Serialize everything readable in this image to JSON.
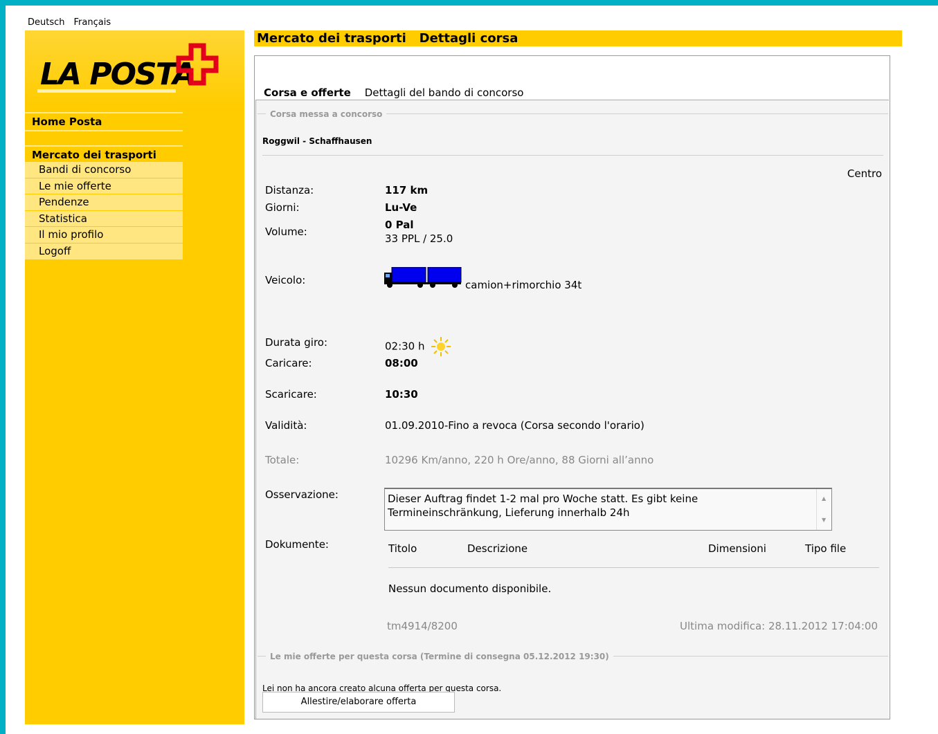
{
  "lang": {
    "de": "Deutsch",
    "fr": "Français"
  },
  "logo": {
    "text": "LA POSTA",
    "brand_color": "#ffcc00",
    "cross_color": "#e2001a"
  },
  "nav": {
    "home": "Home Posta",
    "section": "Mercato dei trasporti",
    "items": [
      {
        "label": "Bandi di concorso"
      },
      {
        "label": "Le mie offerte"
      },
      {
        "label": "Pendenze"
      },
      {
        "label": "Statistica"
      },
      {
        "label": "Il mio profilo"
      },
      {
        "label": "Logoff"
      }
    ]
  },
  "header": {
    "title": "Mercato dei trasporti   Dettagli corsa"
  },
  "tabs": {
    "active": "Corsa e offerte",
    "other": "Dettagli del bando di concorso"
  },
  "trip": {
    "legend": "Corsa messa a concorso",
    "route": "Roggwil - Schaffhausen",
    "centro": "Centro",
    "distance_label": "Distanza:",
    "distance": "117 km",
    "days_label": "Giorni:",
    "days": "Lu-Ve",
    "volume_label": "Volume:",
    "volume_pal": "0 Pal",
    "volume_ppl": "33 PPL / 25.0",
    "vehicle_label": "Veicolo:",
    "vehicle": "camion+rimorchio 34t",
    "vehicle_icon": "truck-trailer-icon",
    "duration_label": "Durata giro:",
    "duration": "02:30 h",
    "duration_icon": "sun-icon",
    "load_label": "Caricare:",
    "load": "08:00",
    "unload_label": "Scaricare:",
    "unload": "10:30",
    "validity_label": "Validità:",
    "validity": "01.09.2010-Fino a revoca (Corsa secondo l'orario)",
    "total_label": "Totale:",
    "total": "10296 Km/anno, 220 h Ore/anno, 88 Giorni all’anno",
    "remark_label": "Osservazione:",
    "remark": "Dieser Auftrag findet 1-2 mal pro Woche statt. Es gibt keine Termineinschränkung, Lieferung innerhalb 24h",
    "docs_label": "Dokumente:",
    "docs_columns": [
      "Titolo",
      "Descrizione",
      "Dimensioni",
      "Tipo file"
    ],
    "no_docs": "Nessun documento disponibile.",
    "id": "tm4914/8200",
    "modified": "Ultima modifica: 28.11.2012 17:04:00"
  },
  "offers": {
    "legend": "Le mie offerte per questa corsa (Termine di consegna 05.12.2012 19:30)",
    "none": "Lei non ha ancora creato alcuna offerta per questa corsa.",
    "button": "Allestire/elaborare offerta"
  }
}
